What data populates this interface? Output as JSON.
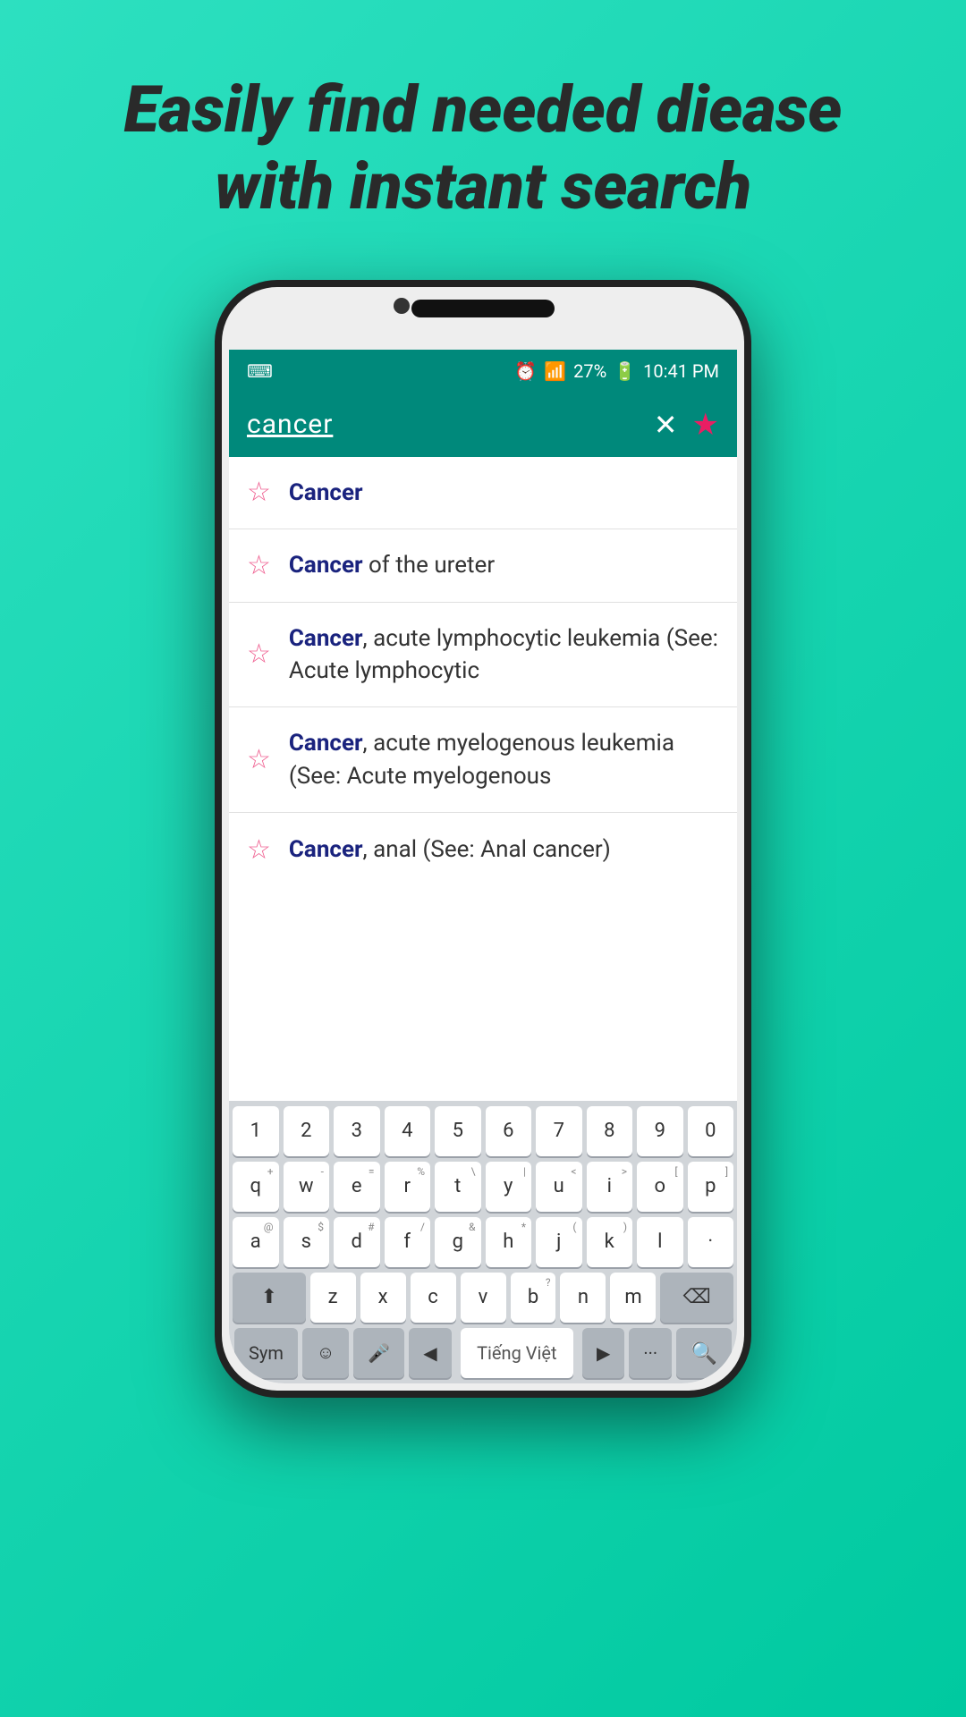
{
  "headline": {
    "line1": "Easily find needed diease",
    "line2": "with instant search"
  },
  "status_bar": {
    "left_icon": "⌨",
    "alarm_icon": "⏰",
    "signal_icon": "📶",
    "battery_percent": "27%",
    "battery_icon": "🔋",
    "time": "10:41 PM"
  },
  "search_bar": {
    "query": "cancer",
    "clear_label": "✕",
    "star_label": "★"
  },
  "results": [
    {
      "keyword": "Cancer",
      "rest": ""
    },
    {
      "keyword": "Cancer",
      "rest": " of the ureter"
    },
    {
      "keyword": "Cancer",
      "rest": ", acute lymphocytic leukemia (See: Acute lymphocytic"
    },
    {
      "keyword": "Cancer",
      "rest": ", acute myelogenous leukemia (See: Acute myelogenous"
    },
    {
      "keyword": "Cancer",
      "rest": ", anal (See: Anal cancer)"
    }
  ],
  "keyboard": {
    "row1": [
      "1",
      "2",
      "3",
      "4",
      "5",
      "6",
      "7",
      "8",
      "9",
      "0"
    ],
    "row2": [
      "q",
      "w",
      "e",
      "r",
      "t",
      "y",
      "u",
      "i",
      "o",
      "p"
    ],
    "row3": [
      "a",
      "s",
      "d",
      "f",
      "g",
      "h",
      "j",
      "k",
      "l",
      "·"
    ],
    "row4_shift": "⬆",
    "row4": [
      "z",
      "x",
      "c",
      "v",
      "b",
      "n",
      "m"
    ],
    "row4_del": "⌫",
    "row5_sym": "Sym",
    "row5_emoji": "☺",
    "row5_mic": "🎤",
    "row5_left": "◀",
    "row5_lang": "Tiếng Việt",
    "row5_right": "▶",
    "row5_dots": "···",
    "row5_search": "🔍",
    "row2_superscripts": [
      "+",
      "-",
      "=",
      "%",
      "\\",
      "|",
      "<",
      ">",
      "[",
      "]"
    ],
    "row3_superscripts": [
      "@",
      "$",
      "#",
      "/",
      "&",
      "*",
      "(",
      ")",
      "\"\""
    ]
  }
}
